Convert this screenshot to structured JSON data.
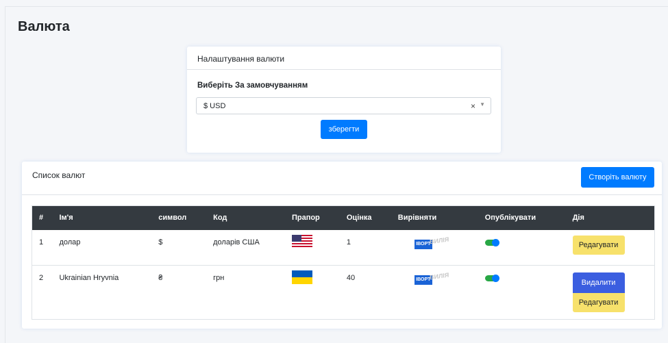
{
  "page": {
    "title": "Валюта"
  },
  "settings": {
    "header": "Налаштування валюти",
    "field_label": "Виберіть За замовчуванням",
    "selected_value": "$ USD",
    "clear_glyph": "×",
    "arrow_glyph": "▼",
    "save_label": "зберегти"
  },
  "list": {
    "title": "Список валют",
    "create_label": "Створіть валюту",
    "columns": [
      "#",
      "Ім'я",
      "символ",
      "Код",
      "Прапор",
      "Оцінка",
      "Вирівняти",
      "Опублікувати",
      "Дія"
    ],
    "rows": [
      {
        "num": "1",
        "name": "долар",
        "symbol": "$",
        "code": "доларів США",
        "flag": "us-flag-icon",
        "rate": "1",
        "align_text_a": "ІВОРТ",
        "align_text_b": "ВИЛІЯ",
        "published": true,
        "edit_label": "Редагувати"
      },
      {
        "num": "2",
        "name": "Ukrainian Hryvnia",
        "symbol": "₴",
        "code": "грн",
        "flag": "ua-flag-icon",
        "rate": "40",
        "align_text_a": "ІВОРТ",
        "align_text_b": "ВИЛІЯ",
        "published": true,
        "delete_label": "Видалити",
        "edit_label": "Редагувати"
      }
    ]
  },
  "colors": {
    "primary": "#007bff",
    "table_header": "#343a40",
    "edit_button": "#f7e16b",
    "delete_button": "#3b5ee0",
    "toggle_on": "#28a745"
  }
}
